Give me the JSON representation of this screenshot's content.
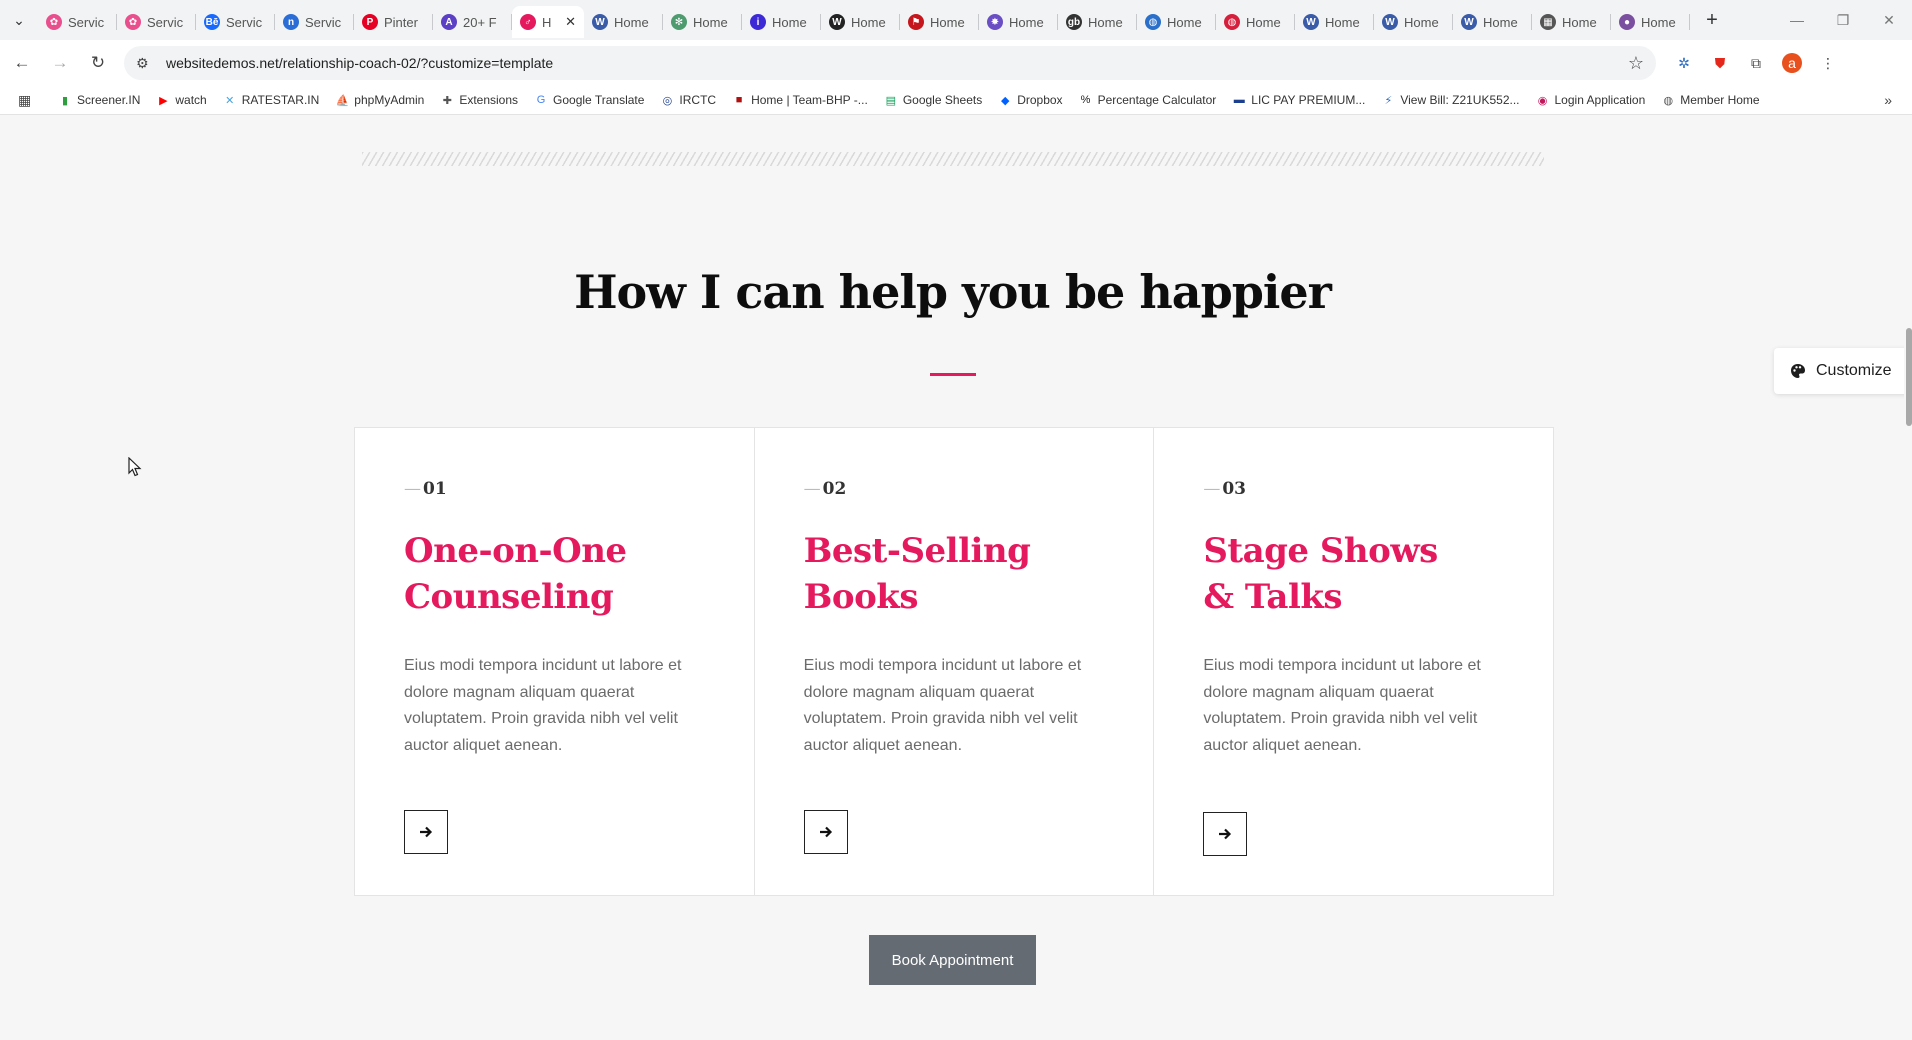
{
  "browser": {
    "tabs": [
      {
        "label": "Servic",
        "fav_color": "#e94f8c",
        "fav_glyph": "✿"
      },
      {
        "label": "Servic",
        "fav_color": "#e94f8c",
        "fav_glyph": "✿"
      },
      {
        "label": "Servic",
        "fav_color": "#1769ff",
        "fav_glyph": "Bē"
      },
      {
        "label": "Servic",
        "fav_color": "#2b6dd6",
        "fav_glyph": "n"
      },
      {
        "label": "Pinter",
        "fav_color": "#e60023",
        "fav_glyph": "P"
      },
      {
        "label": "20+ F",
        "fav_color": "#5b3fc4",
        "fav_glyph": "A"
      },
      {
        "label": "H",
        "fav_color": "#e5195d",
        "fav_glyph": "♂",
        "active": true
      },
      {
        "label": "Home",
        "fav_color": "#3a5ba8",
        "fav_glyph": "W"
      },
      {
        "label": "Home",
        "fav_color": "#4d9b6f",
        "fav_glyph": "✻"
      },
      {
        "label": "Home",
        "fav_color": "#3d2ad6",
        "fav_glyph": "i"
      },
      {
        "label": "Home",
        "fav_color": "#222222",
        "fav_glyph": "W"
      },
      {
        "label": "Home",
        "fav_color": "#c4161c",
        "fav_glyph": "⚑"
      },
      {
        "label": "Home",
        "fav_color": "#6a4fc4",
        "fav_glyph": "✸"
      },
      {
        "label": "Home",
        "fav_color": "#333333",
        "fav_glyph": "gb"
      },
      {
        "label": "Home",
        "fav_color": "#2a6fc9",
        "fav_glyph": "◍"
      },
      {
        "label": "Home",
        "fav_color": "#d61f3c",
        "fav_glyph": "◍"
      },
      {
        "label": "Home",
        "fav_color": "#3a5ba8",
        "fav_glyph": "W"
      },
      {
        "label": "Home",
        "fav_color": "#3a5ba8",
        "fav_glyph": "W"
      },
      {
        "label": "Home",
        "fav_color": "#3a5ba8",
        "fav_glyph": "W"
      },
      {
        "label": "Home",
        "fav_color": "#555555",
        "fav_glyph": "▦"
      },
      {
        "label": "Home",
        "fav_color": "#7b4fa0",
        "fav_glyph": "●"
      }
    ],
    "url": "websitedemos.net/relationship-coach-02/?customize=template",
    "profile_initial": "a",
    "bookmarks": [
      {
        "label": "Screener.IN",
        "icon": "bar-chart-icon",
        "color": "#2e9e3e",
        "glyph": "▮"
      },
      {
        "label": "watch",
        "icon": "youtube-icon",
        "color": "#ff0000",
        "glyph": "▶"
      },
      {
        "label": "RATESTAR.IN",
        "icon": "ratestar-icon",
        "color": "#4aa3df",
        "glyph": "✕"
      },
      {
        "label": "phpMyAdmin",
        "icon": "phpmyadmin-icon",
        "color": "#e78a1c",
        "glyph": "⛵"
      },
      {
        "label": "Extensions",
        "icon": "puzzle-icon",
        "color": "#555555",
        "glyph": "✚"
      },
      {
        "label": "Google Translate",
        "icon": "translate-icon",
        "color": "#4285f4",
        "glyph": "G"
      },
      {
        "label": "IRCTC",
        "icon": "irctc-icon",
        "color": "#1d3f8f",
        "glyph": "◎"
      },
      {
        "label": "Home | Team-BHP -...",
        "icon": "team-bhp-icon",
        "color": "#b01010",
        "glyph": "■"
      },
      {
        "label": "Google Sheets",
        "icon": "sheets-icon",
        "color": "#0f9d58",
        "glyph": "▤"
      },
      {
        "label": "Dropbox",
        "icon": "dropbox-icon",
        "color": "#0061ff",
        "glyph": "◆"
      },
      {
        "label": "Percentage Calculator",
        "icon": "percent-icon",
        "color": "#1a1a1a",
        "glyph": "%"
      },
      {
        "label": "LIC PAY PREMIUM...",
        "icon": "lic-icon",
        "color": "#1d3f8f",
        "glyph": "▬"
      },
      {
        "label": "View Bill: Z21UK552...",
        "icon": "bill-icon",
        "color": "#2d6cc0",
        "glyph": "⚡"
      },
      {
        "label": "Login Application",
        "icon": "login-icon",
        "color": "#c2185b",
        "glyph": "◉"
      },
      {
        "label": "Member Home",
        "icon": "globe-icon",
        "color": "#555555",
        "glyph": "◍"
      }
    ]
  },
  "section": {
    "title": "How I can help you be happier",
    "accent_color": "#e5195d"
  },
  "cards": [
    {
      "number": "01",
      "title_line1": "One-on-One",
      "title_line2": "Counseling",
      "text": "Eius modi tempora incidunt ut labore et dolore magnam aliquam quaerat voluptatem. Proin gravida nibh vel velit auctor aliquet aenean."
    },
    {
      "number": "02",
      "title_line1": "Best-Selling",
      "title_line2": "Books",
      "text": "Eius modi tempora incidunt ut labore et dolore magnam aliquam quaerat voluptatem. Proin gravida nibh vel velit auctor aliquet aenean."
    },
    {
      "number": "03",
      "title_line1": "Stage Shows",
      "title_line2": "& Talks",
      "text": "Eius modi tempora incidunt ut labore et dolore magnam aliquam quaerat voluptatem. Proin gravida nibh vel velit auctor aliquet aenean."
    }
  ],
  "book_button_label": "Book Appointment",
  "customize_label": "Customize"
}
